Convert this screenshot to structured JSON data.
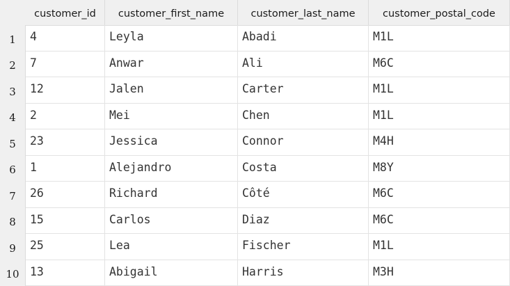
{
  "columns": [
    "customer_id",
    "customer_first_name",
    "customer_last_name",
    "customer_postal_code"
  ],
  "rows": [
    {
      "num": "1",
      "cells": [
        "4",
        "Leyla",
        "Abadi",
        "M1L"
      ]
    },
    {
      "num": "2",
      "cells": [
        "7",
        "Anwar",
        "Ali",
        "M6C"
      ]
    },
    {
      "num": "3",
      "cells": [
        "12",
        "Jalen",
        "Carter",
        "M1L"
      ]
    },
    {
      "num": "4",
      "cells": [
        "2",
        "Mei",
        "Chen",
        "M1L"
      ]
    },
    {
      "num": "5",
      "cells": [
        "23",
        "Jessica",
        "Connor",
        "M4H"
      ]
    },
    {
      "num": "6",
      "cells": [
        "1",
        "Alejandro",
        "Costa",
        "M8Y"
      ]
    },
    {
      "num": "7",
      "cells": [
        "26",
        "Richard",
        "Côté",
        "M6C"
      ]
    },
    {
      "num": "8",
      "cells": [
        "15",
        "Carlos",
        "Diaz",
        "M6C"
      ]
    },
    {
      "num": "9",
      "cells": [
        "25",
        "Lea",
        "Fischer",
        "M1L"
      ]
    },
    {
      "num": "10",
      "cells": [
        "13",
        "Abigail",
        "Harris",
        "M3H"
      ]
    }
  ]
}
